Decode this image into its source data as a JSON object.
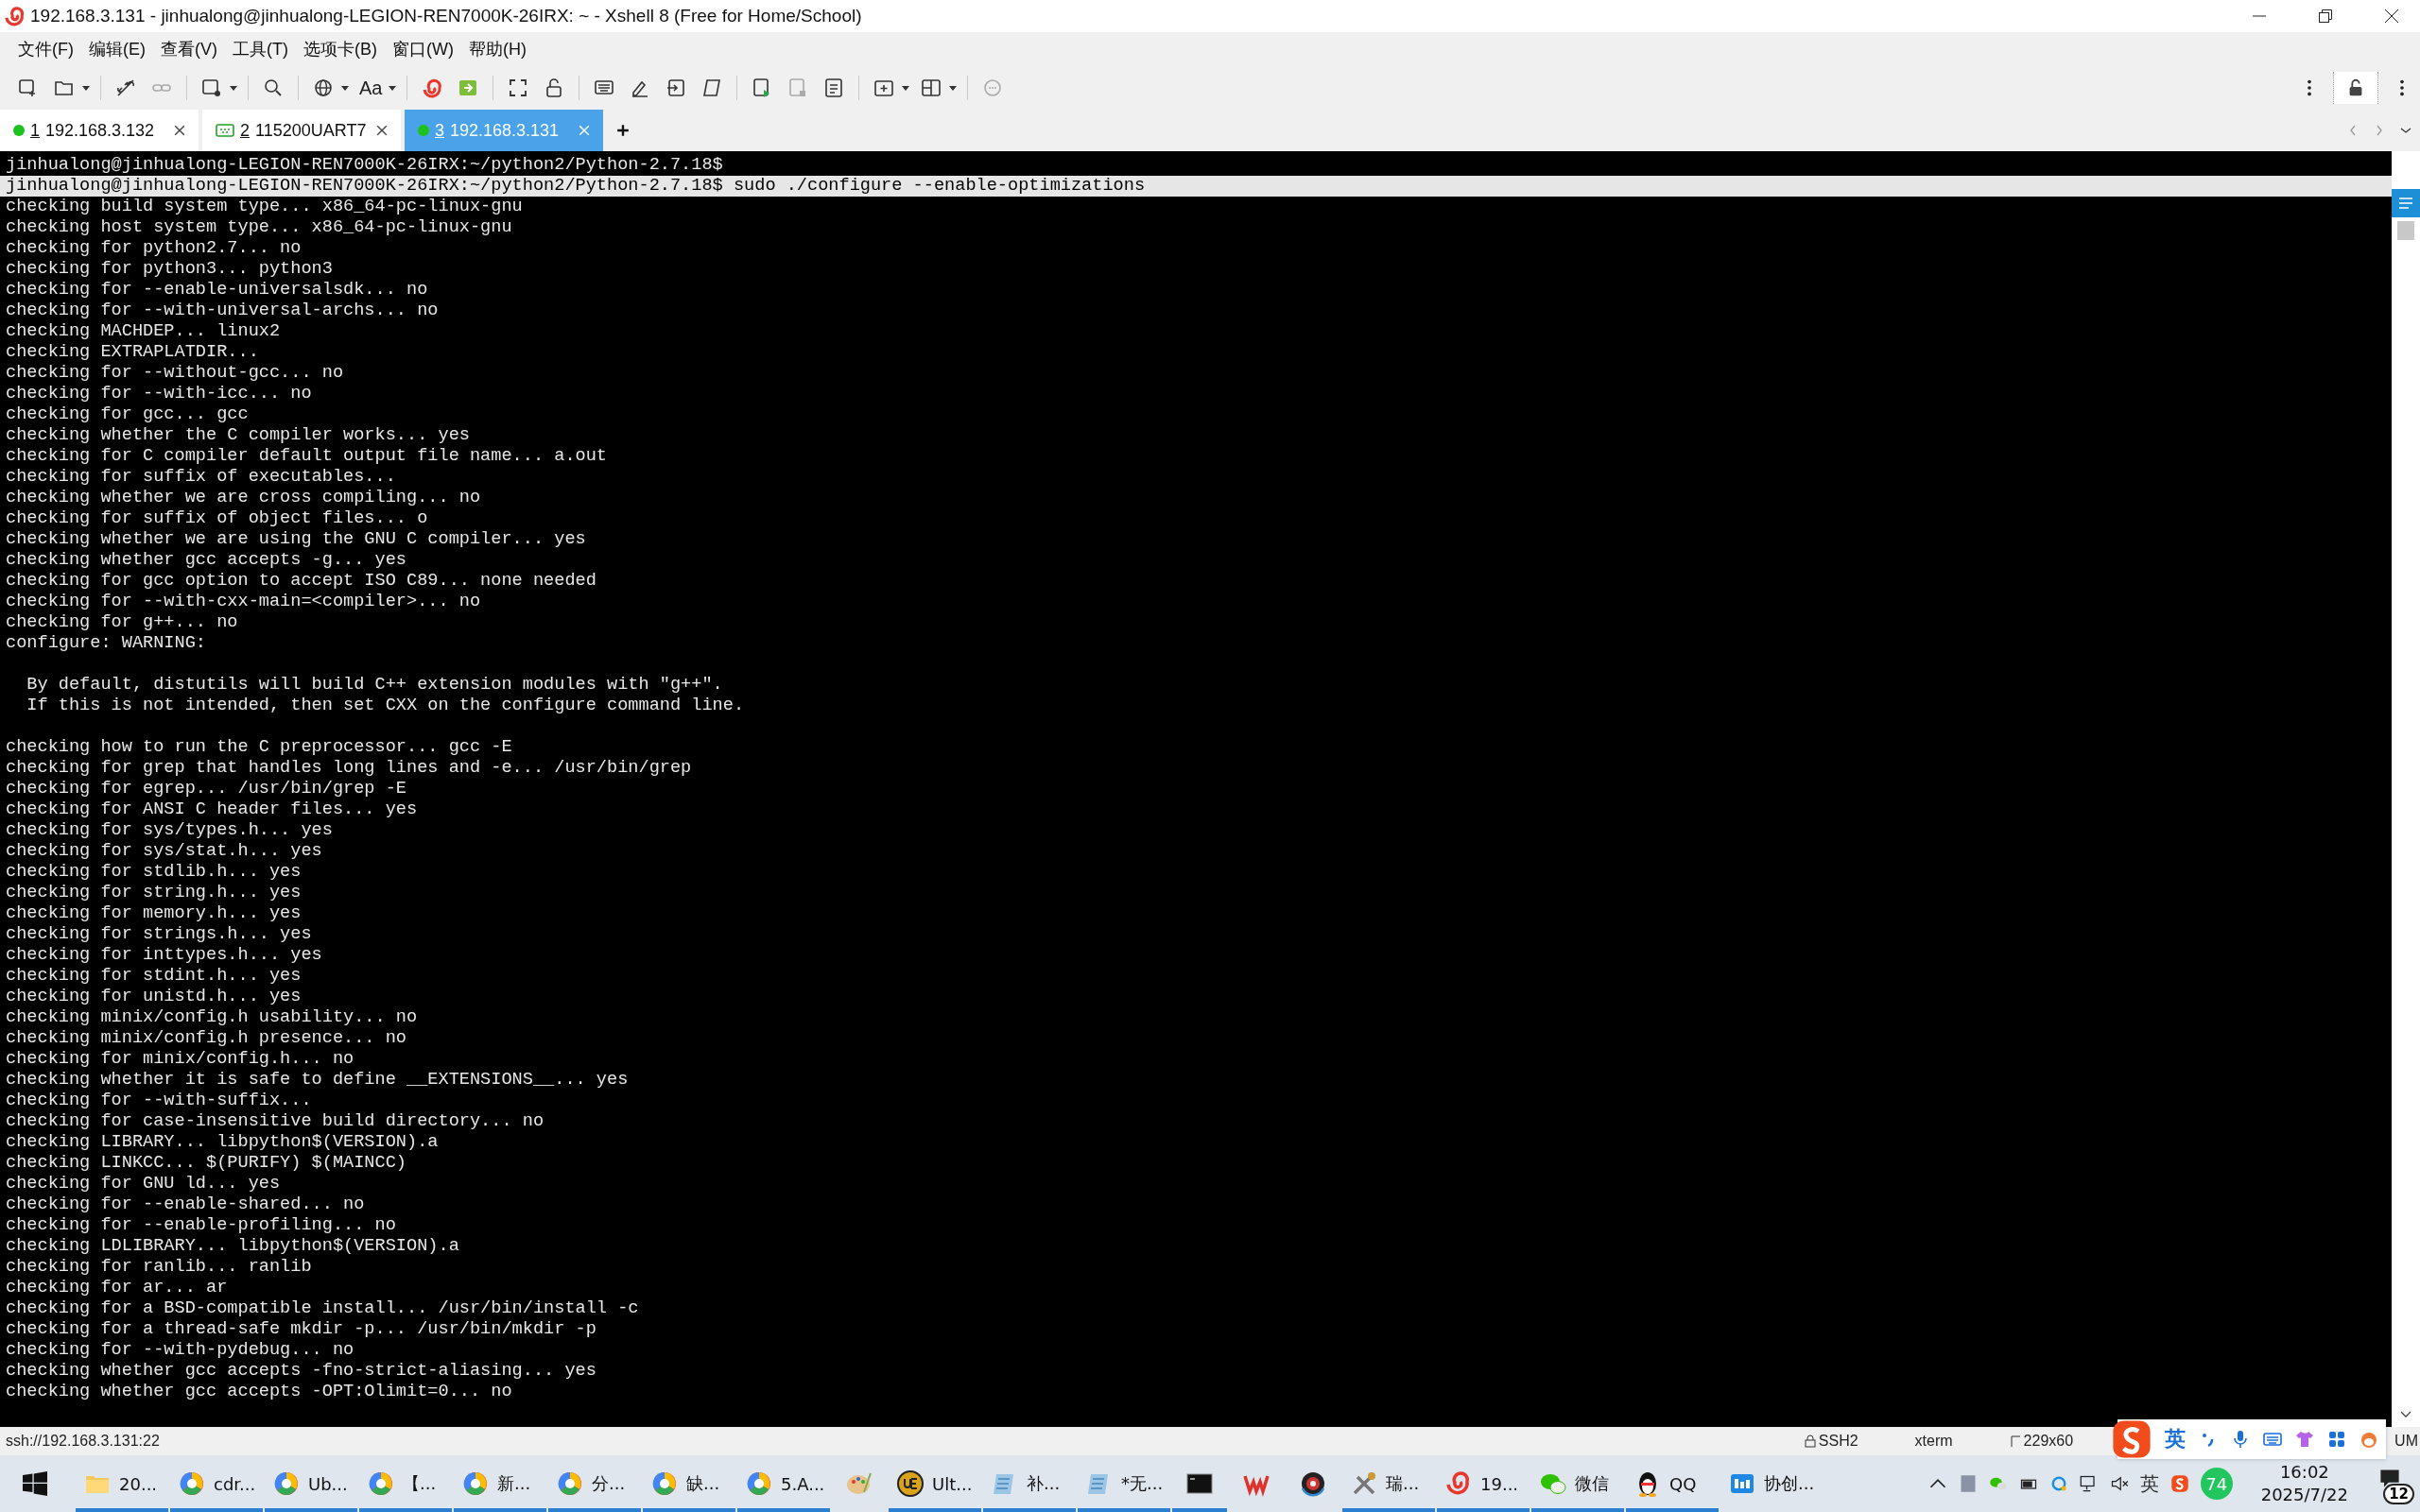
{
  "window": {
    "title": "192.168.3.131 - jinhualong@jinhualong-LEGION-REN7000K-26IRX: ~ - Xshell 8 (Free for Home/School)"
  },
  "menu": [
    "文件(F)",
    "编辑(E)",
    "查看(V)",
    "工具(T)",
    "选项卡(B)",
    "窗口(W)",
    "帮助(H)"
  ],
  "toolbar": {
    "font_label": "Aa"
  },
  "tabs": [
    {
      "number": "1",
      "label": "192.168.3.132",
      "kind": "ssh",
      "color": "#1ec21e",
      "selected": false
    },
    {
      "number": "2",
      "label": "115200UART7",
      "kind": "serial",
      "selected": false
    },
    {
      "number": "3",
      "label": "192.168.3.131",
      "kind": "ssh",
      "color": "#1ec21e",
      "selected": true
    }
  ],
  "terminal": {
    "blocks": [
      [
        {
          "text": "jinhualong@jinhualong-LEGION-REN7000K-26IRX:~/python2/Python-2.7.18$",
          "selected": false
        },
        {
          "text": "jinhualong@jinhualong-LEGION-REN7000K-26IRX:~/python2/Python-2.7.18$ sudo ./configure --enable-optimizations",
          "selected": true
        },
        {
          "text": "checking build system type... x86_64-pc-linux-gnu",
          "selected": false
        },
        {
          "text": "checking host system type... x86_64-pc-linux-gnu",
          "selected": false
        },
        {
          "text": "checking for python2.7... no",
          "selected": false
        },
        {
          "text": "checking for python3... python3",
          "selected": false
        },
        {
          "text": "checking for --enable-universalsdk... no",
          "selected": false
        },
        {
          "text": "checking for --with-universal-archs... no",
          "selected": false
        },
        {
          "text": "checking MACHDEP... linux2",
          "selected": false
        },
        {
          "text": "checking EXTRAPLATDIR...",
          "selected": false
        },
        {
          "text": "checking for --without-gcc... no",
          "selected": false
        },
        {
          "text": "checking for --with-icc... no",
          "selected": false
        },
        {
          "text": "checking for gcc... gcc",
          "selected": false
        },
        {
          "text": "checking whether the C compiler works... yes",
          "selected": false
        },
        {
          "text": "checking for C compiler default output file name... a.out",
          "selected": false
        },
        {
          "text": "checking for suffix of executables...",
          "selected": false
        },
        {
          "text": "checking whether we are cross compiling... no",
          "selected": false
        },
        {
          "text": "checking for suffix of object files... o",
          "selected": false
        },
        {
          "text": "checking whether we are using the GNU C compiler... yes",
          "selected": false
        },
        {
          "text": "checking whether gcc accepts -g... yes",
          "selected": false
        },
        {
          "text": "checking for gcc option to accept ISO C89... none needed",
          "selected": false
        },
        {
          "text": "checking for --with-cxx-main=<compiler>... no",
          "selected": false
        },
        {
          "text": "checking for g++... no",
          "selected": false
        },
        {
          "text": "configure: WARNING:",
          "selected": false
        }
      ],
      [
        {
          "text": "  By default, distutils will build C++ extension modules with \"g++\".",
          "selected": false
        },
        {
          "text": "  If this is not intended, then set CXX on the configure command line.",
          "selected": false
        }
      ],
      [
        {
          "text": "checking how to run the C preprocessor... gcc -E",
          "selected": false
        },
        {
          "text": "checking for grep that handles long lines and -e... /usr/bin/grep",
          "selected": false
        },
        {
          "text": "checking for egrep... /usr/bin/grep -E",
          "selected": false
        },
        {
          "text": "checking for ANSI C header files... yes",
          "selected": false
        },
        {
          "text": "checking for sys/types.h... yes",
          "selected": false
        },
        {
          "text": "checking for sys/stat.h... yes",
          "selected": false
        },
        {
          "text": "checking for stdlib.h... yes",
          "selected": false
        },
        {
          "text": "checking for string.h... yes",
          "selected": false
        },
        {
          "text": "checking for memory.h... yes",
          "selected": false
        },
        {
          "text": "checking for strings.h... yes",
          "selected": false
        },
        {
          "text": "checking for inttypes.h... yes",
          "selected": false
        },
        {
          "text": "checking for stdint.h... yes",
          "selected": false
        },
        {
          "text": "checking for unistd.h... yes",
          "selected": false
        },
        {
          "text": "checking minix/config.h usability... no",
          "selected": false
        },
        {
          "text": "checking minix/config.h presence... no",
          "selected": false
        },
        {
          "text": "checking for minix/config.h... no",
          "selected": false
        },
        {
          "text": "checking whether it is safe to define __EXTENSIONS__... yes",
          "selected": false
        },
        {
          "text": "checking for --with-suffix...",
          "selected": false
        },
        {
          "text": "checking for case-insensitive build directory... no",
          "selected": false
        },
        {
          "text": "checking LIBRARY... libpython$(VERSION).a",
          "selected": false
        },
        {
          "text": "checking LINKCC... $(PURIFY) $(MAINCC)",
          "selected": false
        },
        {
          "text": "checking for GNU ld... yes",
          "selected": false
        },
        {
          "text": "checking for --enable-shared... no",
          "selected": false
        },
        {
          "text": "checking for --enable-profiling... no",
          "selected": false
        },
        {
          "text": "checking LDLIBRARY... libpython$(VERSION).a",
          "selected": false
        },
        {
          "text": "checking for ranlib... ranlib",
          "selected": false
        },
        {
          "text": "checking for ar... ar",
          "selected": false
        },
        {
          "text": "checking for a BSD-compatible install... /usr/bin/install -c",
          "selected": false
        },
        {
          "text": "checking for a thread-safe mkdir -p... /usr/bin/mkdir -p",
          "selected": false
        },
        {
          "text": "checking for --with-pydebug... no",
          "selected": false
        },
        {
          "text": "checking whether gcc accepts -fno-strict-aliasing... yes",
          "selected": false
        },
        {
          "text": "checking whether gcc accepts -OPT:Olimit=0... no",
          "selected": false
        }
      ]
    ]
  },
  "status_bar": {
    "address": "ssh://192.168.3.131:22",
    "protocol": "SSH2",
    "terminal_type": "xterm",
    "size": "229x60",
    "num_lock": "UM"
  },
  "ime_bar": {
    "language": "英"
  },
  "taskbar": {
    "items": [
      {
        "kind": "folder",
        "label": "20...",
        "open": true
      },
      {
        "kind": "browser",
        "label": "cdr...",
        "open": true
      },
      {
        "kind": "browser",
        "label": "Ub...",
        "open": true
      },
      {
        "kind": "browser",
        "label": "【...",
        "open": true
      },
      {
        "kind": "browser",
        "label": "新...",
        "open": true
      },
      {
        "kind": "browser",
        "label": "分...",
        "open": true
      },
      {
        "kind": "browser",
        "label": "缺...",
        "open": true
      },
      {
        "kind": "browser",
        "label": "5.A...",
        "open": true
      },
      {
        "kind": "paint",
        "open": false
      },
      {
        "kind": "editor",
        "label": "Ult...",
        "open": true
      },
      {
        "kind": "notepad",
        "label": "补...",
        "open": true
      },
      {
        "kind": "notepad",
        "label": "*无...",
        "open": true
      },
      {
        "kind": "console",
        "open": true
      },
      {
        "kind": "office",
        "open": false
      },
      {
        "kind": "disc",
        "open": false
      },
      {
        "kind": "tools",
        "label": "瑞...",
        "open": true
      },
      {
        "kind": "shell",
        "label": "19...",
        "open": true
      },
      {
        "kind": "chat",
        "label": "微信",
        "open": true
      },
      {
        "kind": "penguin",
        "label": "QQ",
        "open": true
      },
      {
        "kind": "board",
        "label": "协创...",
        "open": false
      }
    ],
    "tray": {
      "language": "英",
      "badge": "74",
      "time": "16:02",
      "date": "2025/7/22",
      "notifications": "12"
    }
  }
}
